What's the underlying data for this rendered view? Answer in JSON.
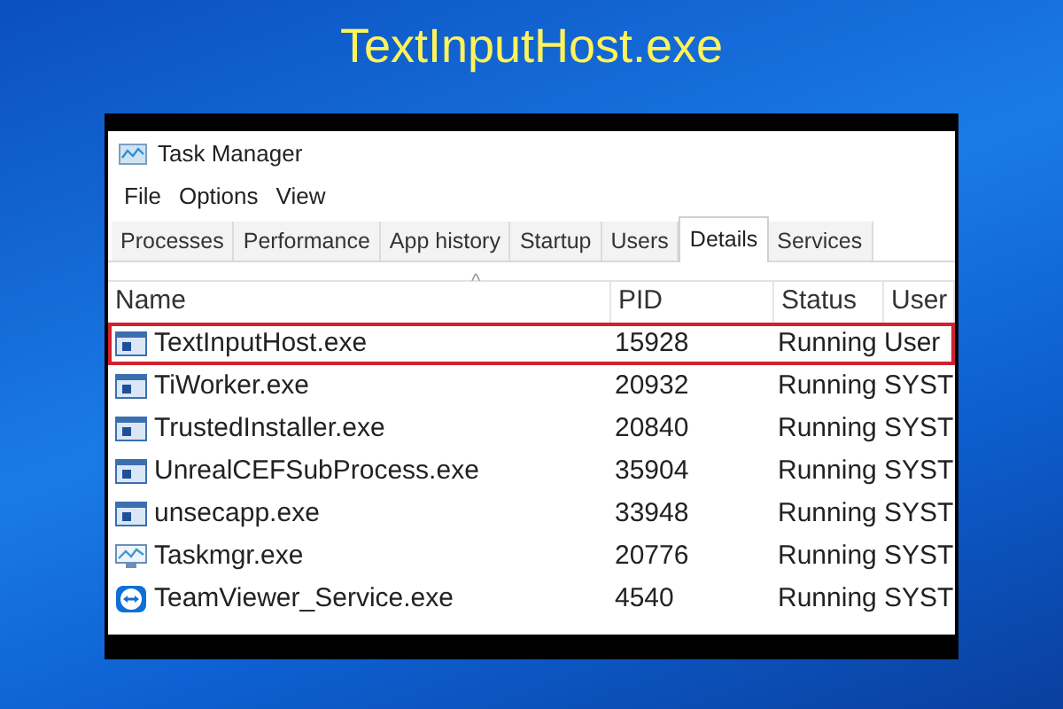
{
  "headline": "TextInputHost.exe",
  "window": {
    "title": "Task Manager"
  },
  "menu": [
    "File",
    "Options",
    "View"
  ],
  "tabs": [
    {
      "label": "Processes",
      "selected": false
    },
    {
      "label": "Performance",
      "selected": false
    },
    {
      "label": "App history",
      "selected": false
    },
    {
      "label": "Startup",
      "selected": false
    },
    {
      "label": "Users",
      "selected": false
    },
    {
      "label": "Details",
      "selected": true
    },
    {
      "label": "Services",
      "selected": false
    }
  ],
  "table": {
    "sort_indicator": "^",
    "columns": [
      "Name",
      "PID",
      "Status",
      "User"
    ],
    "rows": [
      {
        "kind": "app",
        "name": "TextInputHost.exe",
        "pid": "15928",
        "status": "Running",
        "user": "User",
        "selected": true
      },
      {
        "kind": "app",
        "name": "TiWorker.exe",
        "pid": "20932",
        "status": "Running",
        "user": "SYST",
        "selected": false
      },
      {
        "kind": "app",
        "name": "TrustedInstaller.exe",
        "pid": "20840",
        "status": "Running",
        "user": "SYST",
        "selected": false
      },
      {
        "kind": "app",
        "name": "UnrealCEFSubProcess.exe",
        "pid": "35904",
        "status": "Running",
        "user": "SYST",
        "selected": false
      },
      {
        "kind": "app",
        "name": "unsecapp.exe",
        "pid": "33948",
        "status": "Running",
        "user": "SYST",
        "selected": false
      },
      {
        "kind": "monitor",
        "name": "Taskmgr.exe",
        "pid": "20776",
        "status": "Running",
        "user": "SYST",
        "selected": false
      },
      {
        "kind": "remote",
        "name": "TeamViewer_Service.exe",
        "pid": "4540",
        "status": "Running",
        "user": "SYST",
        "selected": false
      }
    ]
  }
}
